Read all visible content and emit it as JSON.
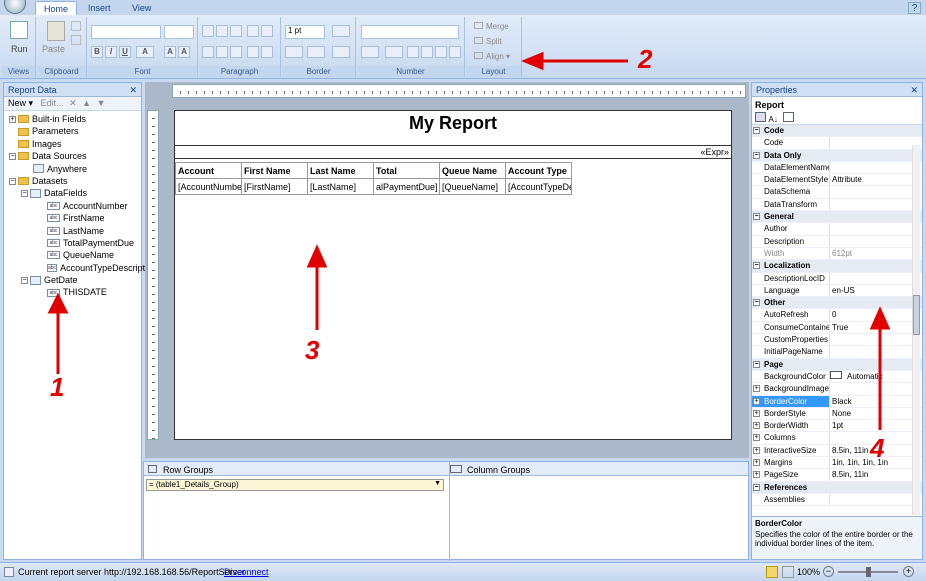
{
  "tabs": [
    "Home",
    "Insert",
    "View"
  ],
  "ribbon": {
    "run_label": "Run",
    "paste_label": "Paste",
    "font_size": "1 pt",
    "merge_label": "Merge",
    "split_label": "Split",
    "align_label": "Align",
    "groups": [
      "Views",
      "Clipboard",
      "Font",
      "Paragraph",
      "Border",
      "Number",
      "Layout"
    ]
  },
  "report_data": {
    "title": "Report Data",
    "new_label": "New",
    "edit_label": "Edit...",
    "tree": [
      "Built-in Fields",
      "Parameters",
      "Images",
      "Data Sources",
      "Anywhere",
      "Datasets",
      "DataFields",
      "AccountNumber",
      "FirstName",
      "LastName",
      "TotalPaymentDue",
      "QueueName",
      "AccountTypeDescript",
      "GetDate",
      "THISDATE"
    ]
  },
  "report": {
    "title": "My Report",
    "expr": "«Expr»",
    "headers": [
      "Account",
      "First Name",
      "Last Name",
      "Total",
      "Queue Name",
      "Account Type"
    ],
    "cells": [
      "[AccountNumbe",
      "[FirstName]",
      "[LastName]",
      "alPaymentDue]",
      "[QueueName]",
      "[AccountTypeDe"
    ]
  },
  "groups": {
    "row_label": "Row Groups",
    "col_label": "Column Groups",
    "row_group": "= (table1_Details_Group)"
  },
  "properties": {
    "title": "Properties",
    "object": "Report",
    "rows": [
      {
        "cat": true,
        "name": "Code"
      },
      {
        "name": "Code",
        "value": ""
      },
      {
        "cat": true,
        "name": "Data Only"
      },
      {
        "name": "DataElementName",
        "value": ""
      },
      {
        "name": "DataElementStyle",
        "value": "Attribute"
      },
      {
        "name": "DataSchema",
        "value": ""
      },
      {
        "name": "DataTransform",
        "value": ""
      },
      {
        "cat": true,
        "name": "General"
      },
      {
        "name": "Author",
        "value": ""
      },
      {
        "name": "Description",
        "value": ""
      },
      {
        "name": "Width",
        "value": "612pt"
      },
      {
        "cat": true,
        "name": "Localization"
      },
      {
        "name": "DescriptionLocID",
        "value": ""
      },
      {
        "name": "Language",
        "value": "en-US"
      },
      {
        "cat": true,
        "name": "Other"
      },
      {
        "name": "AutoRefresh",
        "value": "0"
      },
      {
        "name": "ConsumeContaine",
        "value": "True"
      },
      {
        "name": "CustomProperties",
        "value": ""
      },
      {
        "name": "InitialPageName",
        "value": ""
      },
      {
        "cat": true,
        "name": "Page"
      },
      {
        "name": "BackgroundColor",
        "value": "Automatic"
      },
      {
        "name": "BackgroundImage",
        "value": "",
        "exp": true
      },
      {
        "name": "BorderColor",
        "value": "Black",
        "exp": true,
        "sel": true
      },
      {
        "name": "BorderStyle",
        "value": "None",
        "exp": true
      },
      {
        "name": "BorderWidth",
        "value": "1pt",
        "exp": true
      },
      {
        "name": "Columns",
        "value": "",
        "exp": true
      },
      {
        "name": "InteractiveSize",
        "value": "8.5in, 11in",
        "exp": true
      },
      {
        "name": "Margins",
        "value": "1in, 1in, 1in, 1in",
        "exp": true
      },
      {
        "name": "PageSize",
        "value": "8.5in, 11in",
        "exp": true
      },
      {
        "cat": true,
        "name": "References"
      },
      {
        "name": "Assemblies",
        "value": ""
      }
    ],
    "desc_title": "BorderColor",
    "desc_text": "Specifies the color of the entire border or the individual border lines of the item."
  },
  "status": {
    "server_text": "Current report server http://192.168.168.56/ReportServer",
    "disconnect": "Disconnect",
    "zoom": "100%"
  },
  "annotations": [
    "1",
    "2",
    "3",
    "4"
  ],
  "colors": {
    "arrow": "#e00000",
    "accent": "#15428b"
  }
}
